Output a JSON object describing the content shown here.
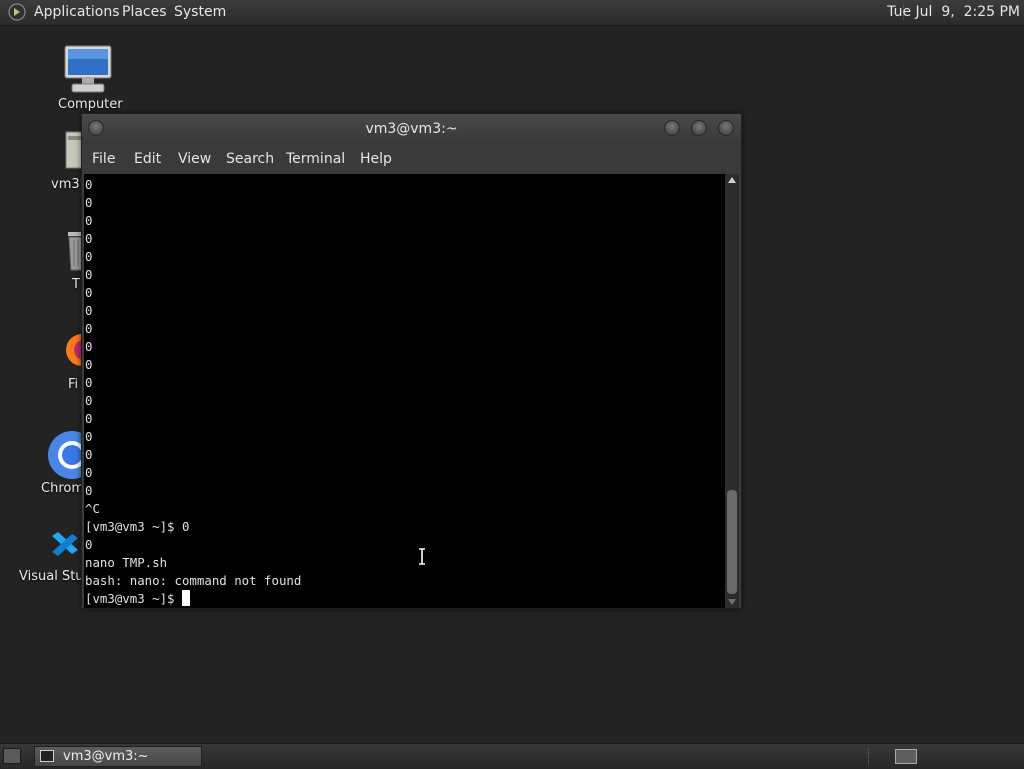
{
  "top_panel": {
    "menus": [
      "Applications",
      "Places",
      "System"
    ],
    "clock": "Tue Jul  9,  2:25 PM"
  },
  "desktop": {
    "icons": [
      {
        "label": "Computer",
        "icon": "computer-icon"
      },
      {
        "label": "vm3'",
        "icon": "home-folder-icon"
      },
      {
        "label": "T",
        "icon": "trash-icon"
      },
      {
        "label": "Fi",
        "icon": "firefox-icon"
      },
      {
        "label": "Chrom",
        "icon": "chrome-icon"
      },
      {
        "label": "Visual Stud",
        "icon": "vscode-icon"
      }
    ]
  },
  "terminal": {
    "title": "vm3@vm3:~",
    "menu": [
      "File",
      "Edit",
      "View",
      "Search",
      "Terminal",
      "Help"
    ],
    "lines": [
      "0",
      "0",
      "0",
      "0",
      "0",
      "0",
      "0",
      "0",
      "0",
      "0",
      "0",
      "0",
      "0",
      "0",
      "0",
      "0",
      "0",
      "0",
      "^C",
      "[vm3@vm3 ~]$ 0",
      "0",
      "nano TMP.sh",
      "bash: nano: command not found"
    ],
    "prompt": "[vm3@vm3 ~]$ "
  },
  "taskbar": {
    "task_label": "vm3@vm3:~"
  }
}
